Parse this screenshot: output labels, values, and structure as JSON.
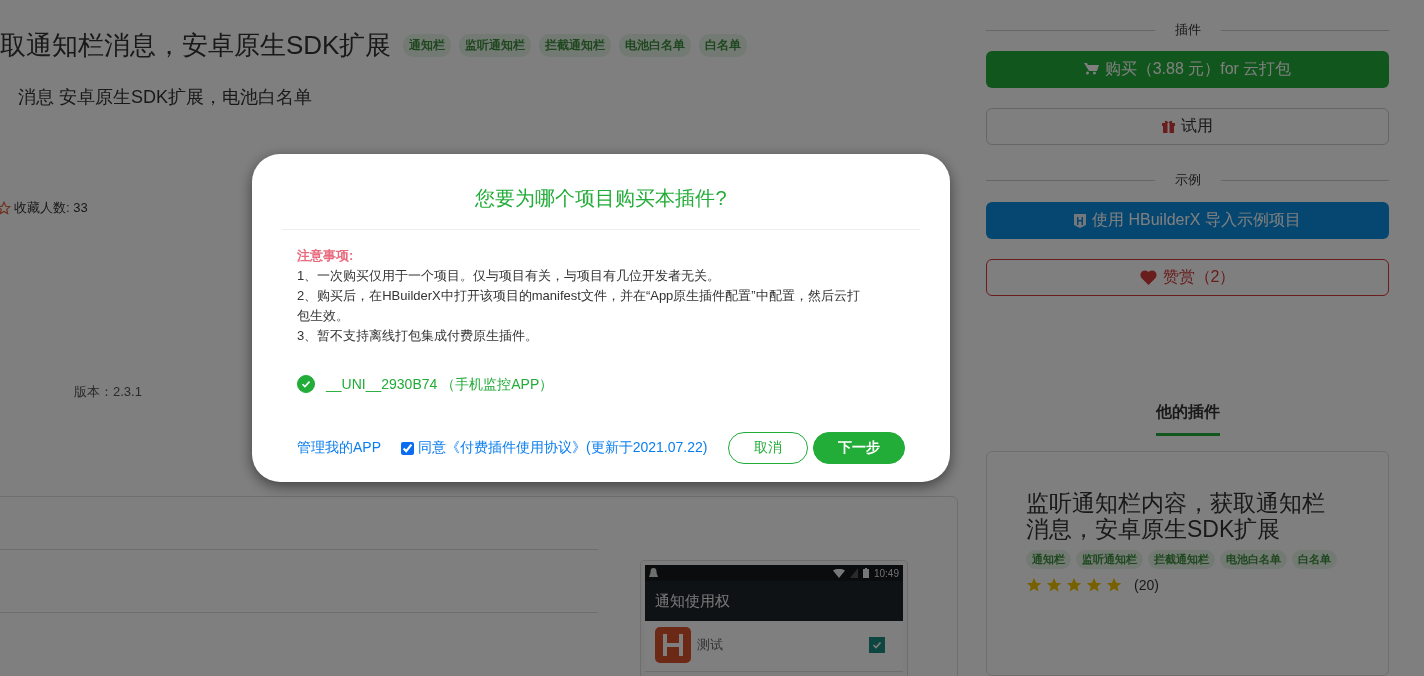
{
  "page": {
    "title": "取通知栏消息，安卓原生SDK扩展",
    "tags": [
      "通知栏",
      "监听通知栏",
      "拦截通知栏",
      "电池白名单",
      "白名单"
    ],
    "subtitle": "消息 安卓原生SDK扩展，电池白名单",
    "favorites": "收藏人数: 33",
    "version": "版本：2.3.1",
    "phone_screenshot": {
      "time": "10:49",
      "title": "通知使用权",
      "app_name": "测试",
      "app_checked": true
    }
  },
  "sidebar": {
    "plugin_heading": "插件",
    "buy_button": "购买（3.88 元）for 云打包",
    "trial_button": "试用",
    "example_heading": "示例",
    "example_button": "使用 HBuilderX 导入示例项目",
    "reward_button": "赞赏（2）",
    "tabs": [
      {
        "label": "他的插件",
        "selected": true
      }
    ],
    "card": {
      "title": "监听通知栏内容，获取通知栏消息，安卓原生SDK扩展",
      "tags": [
        "通知栏",
        "监听通知栏",
        "拦截通知栏",
        "电池白名单",
        "白名单"
      ],
      "stars": 5,
      "review_count": "(20)"
    }
  },
  "dialog": {
    "title": "您要为哪个项目购买本插件?",
    "notice_label": "注意事项:",
    "notice_lines": [
      "1、一次购买仅用于一个项目。仅与项目有关，与项目有几位开发者无关。",
      "2、购买后，在HBuilderX中打开该项目的manifest文件，并在“App原生插件配置”中配置，然后云打包生效。",
      "3、暂不支持离线打包集成付费原生插件。"
    ],
    "projects": [
      {
        "name": "__UNI__2930B74 （手机监控APP）",
        "selected": true
      }
    ],
    "manage_link": "管理我的APP",
    "agreement": {
      "checked": true,
      "text": "同意《付费插件使用协议》(更新于2021.07.22)"
    },
    "buttons": [
      {
        "label": "取消",
        "kind": "secondary"
      },
      {
        "label": "下一步",
        "kind": "primary"
      }
    ]
  }
}
